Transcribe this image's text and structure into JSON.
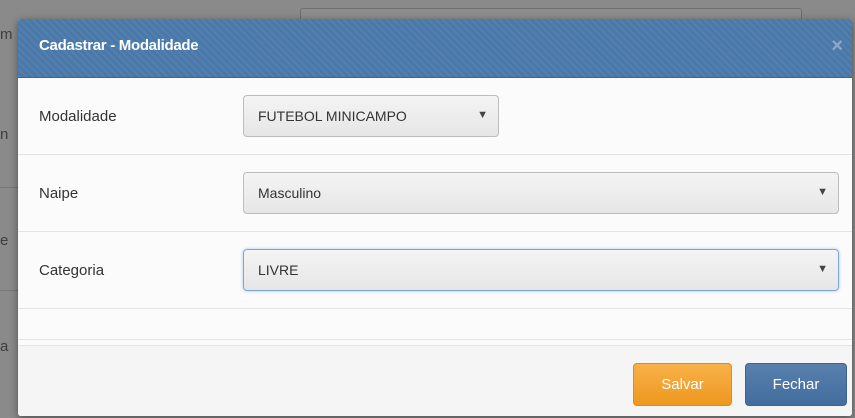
{
  "backdrop": {
    "fragments": [
      "m",
      "n",
      "e",
      "a"
    ]
  },
  "modal": {
    "title": "Cadastrar - Modalidade",
    "close_glyph": "×",
    "fields": {
      "modalidade": {
        "label": "Modalidade",
        "value": "FUTEBOL MINICAMPO"
      },
      "naipe": {
        "label": "Naipe",
        "value": "Masculino"
      },
      "categoria": {
        "label": "Categoria",
        "value": "LIVRE"
      }
    },
    "arrow_glyph": "▼",
    "buttons": {
      "save": "Salvar",
      "close": "Fechar"
    },
    "colors": {
      "header": "#4a79a9",
      "save": "#f0a030",
      "close": "#4a74a4",
      "focus": "#7fa5d8"
    }
  }
}
